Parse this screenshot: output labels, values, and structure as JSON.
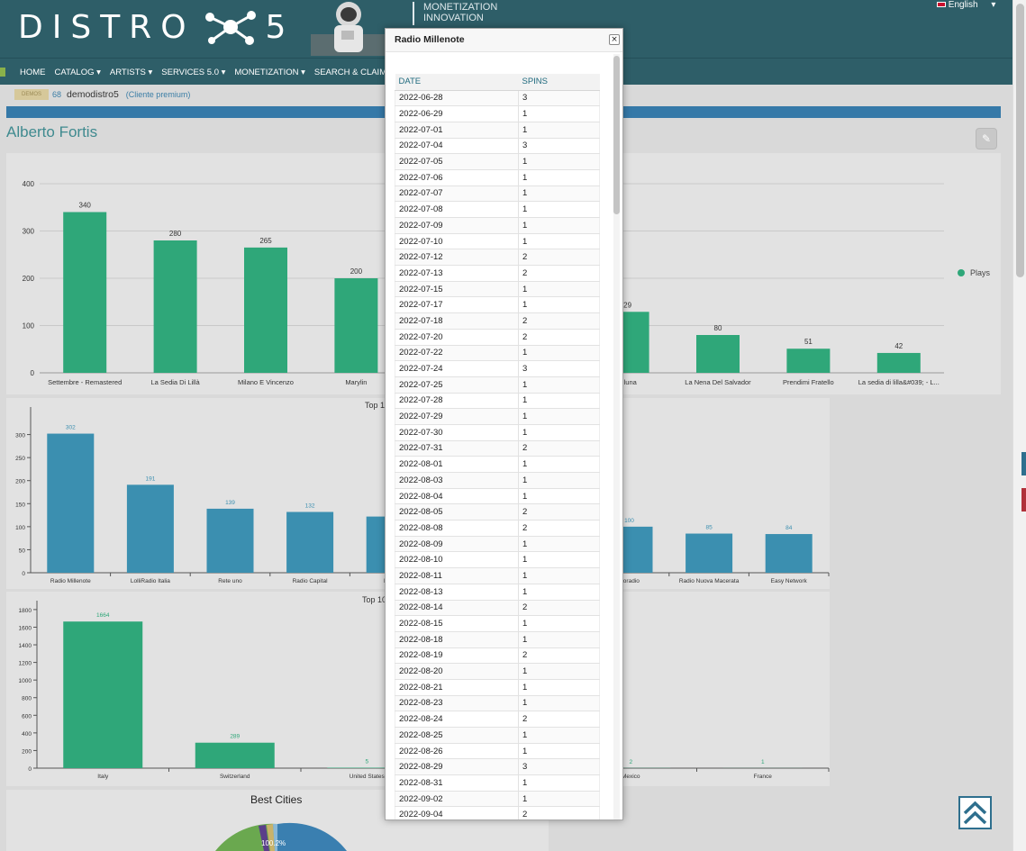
{
  "header": {
    "logo_text_left": "DISTRO",
    "logo_text_right": "5",
    "monetization_line1": "MONETIZATION",
    "monetization_line2": "INNOVATION",
    "language": "English"
  },
  "nav": {
    "items": [
      "HOME",
      "CATALOG ▾",
      "ARTISTS ▾",
      "SERVICES 5.0 ▾",
      "MONETIZATION ▾",
      "SEARCH & CLAIM ▾"
    ]
  },
  "userbar": {
    "badge": "DEMOS",
    "count": "68",
    "username": "demodistro5",
    "plan": "(Cliente premium)"
  },
  "artist_name": "Alberto Fortis",
  "edit_icon": "pencil-icon",
  "legend_plays": "Plays",
  "chart1_title_visible": "Top 1",
  "chart2_title_visible": "Top 10",
  "cities_title": "Best Cities",
  "pie_labels": [
    "100.2%"
  ],
  "colors": {
    "green": "#2fa779",
    "blue": "#3b8fb0",
    "header": "#2e5e68",
    "accent": "#3579a8"
  },
  "chart_data": [
    {
      "type": "bar",
      "categories": [
        "Settembre - Remastered",
        "La Sedia Di Lillà",
        "Milano E Vincenzo",
        "Marylin",
        "",
        "",
        "a luna",
        "La Nena Del Salvador",
        "Prendimi Fratello",
        "La sedia di lilla&#039; - L..."
      ],
      "series": [
        {
          "name": "Plays",
          "values": [
            340,
            280,
            265,
            200,
            null,
            null,
            129,
            80,
            51,
            42
          ]
        }
      ],
      "value_labels": [
        "340",
        "280",
        "265",
        "200",
        "",
        "",
        "29",
        "80",
        "51",
        "42"
      ],
      "yticks": [
        "0",
        "100",
        "200",
        "300",
        "400"
      ],
      "ylim": [
        0,
        400
      ]
    },
    {
      "type": "bar",
      "categories": [
        "Radio Millenote",
        "LolliRadio Italia",
        "Rete uno",
        "Radio Capital",
        "Radi",
        "",
        "",
        "lsoradio",
        "Radio Nuova Macerata",
        "Easy Network"
      ],
      "values": [
        302,
        191,
        139,
        132,
        122,
        null,
        null,
        100,
        85,
        84
      ],
      "value_labels": [
        "302",
        "191",
        "139",
        "132",
        "",
        "",
        "",
        "100",
        "85",
        "84"
      ],
      "yticks": [
        "0",
        "50",
        "100",
        "150",
        "200",
        "250",
        "300"
      ],
      "ylim": [
        0,
        350
      ]
    },
    {
      "type": "bar",
      "categories": [
        "Italy",
        "Switzerland",
        "United States",
        "",
        "Mexico",
        "France"
      ],
      "values": [
        1664,
        289,
        5,
        null,
        2,
        1
      ],
      "value_labels": [
        "1664",
        "289",
        "5",
        "",
        "2",
        "1"
      ],
      "yticks": [
        "0",
        "200",
        "400",
        "600",
        "800",
        "1000",
        "1200",
        "1400",
        "1600",
        "1800"
      ],
      "ylim": [
        0,
        1850
      ]
    }
  ],
  "modal": {
    "title": "Radio Millenote",
    "close_label": "×",
    "col_date": "DATE",
    "col_spins": "SPINS",
    "rows": [
      [
        "2022-06-28",
        "3"
      ],
      [
        "2022-06-29",
        "1"
      ],
      [
        "2022-07-01",
        "1"
      ],
      [
        "2022-07-04",
        "3"
      ],
      [
        "2022-07-05",
        "1"
      ],
      [
        "2022-07-06",
        "1"
      ],
      [
        "2022-07-07",
        "1"
      ],
      [
        "2022-07-08",
        "1"
      ],
      [
        "2022-07-09",
        "1"
      ],
      [
        "2022-07-10",
        "1"
      ],
      [
        "2022-07-12",
        "2"
      ],
      [
        "2022-07-13",
        "2"
      ],
      [
        "2022-07-15",
        "1"
      ],
      [
        "2022-07-17",
        "1"
      ],
      [
        "2022-07-18",
        "2"
      ],
      [
        "2022-07-20",
        "2"
      ],
      [
        "2022-07-22",
        "1"
      ],
      [
        "2022-07-24",
        "3"
      ],
      [
        "2022-07-25",
        "1"
      ],
      [
        "2022-07-28",
        "1"
      ],
      [
        "2022-07-29",
        "1"
      ],
      [
        "2022-07-30",
        "1"
      ],
      [
        "2022-07-31",
        "2"
      ],
      [
        "2022-08-01",
        "1"
      ],
      [
        "2022-08-03",
        "1"
      ],
      [
        "2022-08-04",
        "1"
      ],
      [
        "2022-08-05",
        "2"
      ],
      [
        "2022-08-08",
        "2"
      ],
      [
        "2022-08-09",
        "1"
      ],
      [
        "2022-08-10",
        "1"
      ],
      [
        "2022-08-11",
        "1"
      ],
      [
        "2022-08-13",
        "1"
      ],
      [
        "2022-08-14",
        "2"
      ],
      [
        "2022-08-15",
        "1"
      ],
      [
        "2022-08-18",
        "1"
      ],
      [
        "2022-08-19",
        "2"
      ],
      [
        "2022-08-20",
        "1"
      ],
      [
        "2022-08-21",
        "1"
      ],
      [
        "2022-08-23",
        "1"
      ],
      [
        "2022-08-24",
        "2"
      ],
      [
        "2022-08-25",
        "1"
      ],
      [
        "2022-08-26",
        "1"
      ],
      [
        "2022-08-29",
        "3"
      ],
      [
        "2022-08-31",
        "1"
      ],
      [
        "2022-09-02",
        "1"
      ],
      [
        "2022-09-04",
        "2"
      ]
    ]
  },
  "scroll_top_icon": "double-chevron-up-icon"
}
